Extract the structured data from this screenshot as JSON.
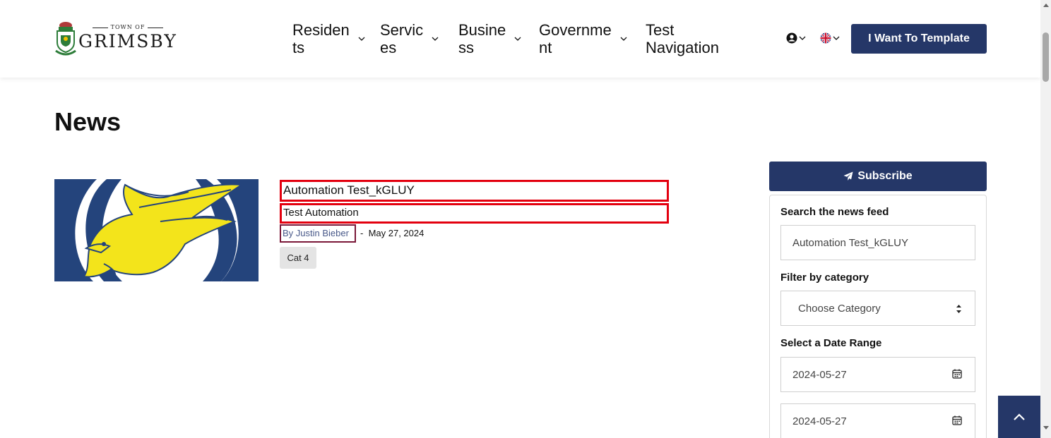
{
  "header": {
    "logo": {
      "small_text": "TOWN OF",
      "name": "GRIMSBY"
    },
    "nav": [
      {
        "label_line1": "Residen",
        "label_line2": "ts"
      },
      {
        "label_line1": "Servic",
        "label_line2": "es"
      },
      {
        "label_line1": "Busine",
        "label_line2": "ss"
      },
      {
        "label_line1": "Governme",
        "label_line2": "nt"
      },
      {
        "label_line1": "Test",
        "label_line2": "Navigation"
      }
    ],
    "account_icon": "user-circle-icon",
    "language_icon": "uk-flag-icon",
    "cta_label": "I Want To Template"
  },
  "main": {
    "page_title": "News",
    "news_items": [
      {
        "image_icon": "eagle-mascot-image",
        "title": "Automation Test_kGLUY",
        "description": "Test Automation",
        "author": "By Justin Bieber",
        "separator": "-",
        "date": "May 27, 2024",
        "category": "Cat 4"
      }
    ]
  },
  "sidebar": {
    "subscribe_label": "Subscribe",
    "subscribe_icon": "paper-plane-icon",
    "search_label": "Search the news feed",
    "search_value": "Automation Test_kGLUY",
    "category_label": "Filter by category",
    "category_value": "Choose Category",
    "date_label": "Select a Date Range",
    "date_from": "2024-05-27",
    "date_to": "2024-05-27"
  },
  "colors": {
    "primary": "#253768",
    "highlight_red": "#e3000f",
    "author_border": "#7a1838"
  }
}
